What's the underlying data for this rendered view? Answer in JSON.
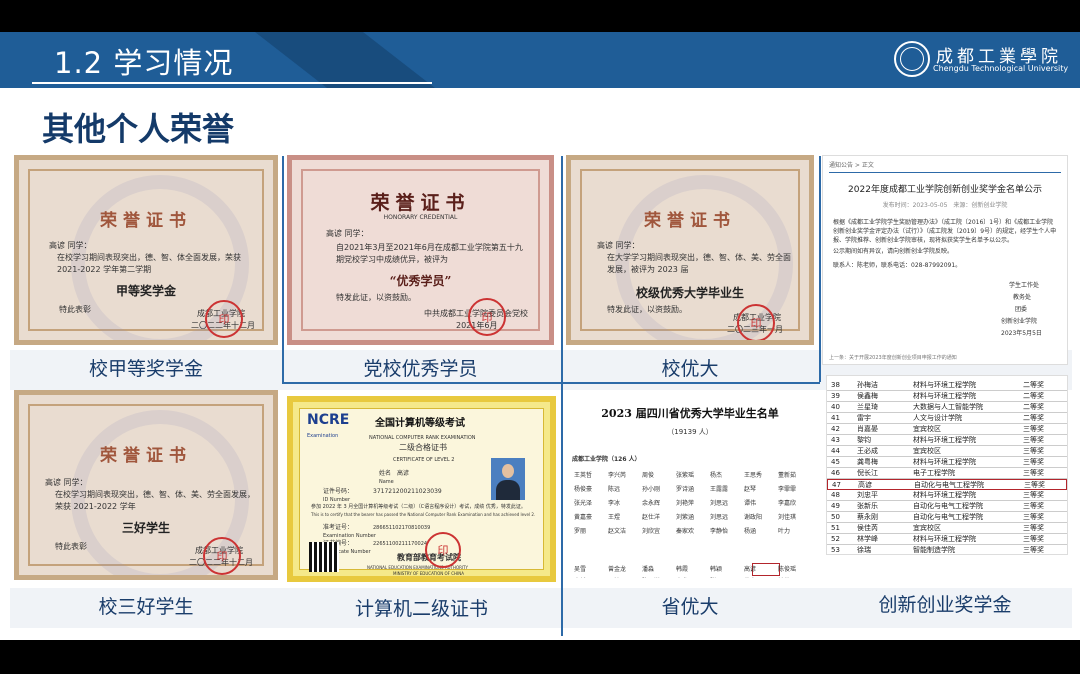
{
  "header": {
    "section_title": "1.2 学习情况",
    "logo_cn": "成都工業學院",
    "logo_en": "Chengdu Technological University"
  },
  "slide_title": "其他个人荣誉",
  "certificates": [
    {
      "title": "荣誉证书",
      "name": "高谚 同学：",
      "body": "在校学习期间表现突出，德、智、体全面发展，荣获 2021-2022 学年第二学期",
      "award": "甲等奖学金",
      "closing": "特此表彰",
      "issuer": "成都工业学院",
      "date": "二〇二二年十二月",
      "caption": "校甲等奖学金"
    },
    {
      "title": "荣誉证书",
      "subtitle": "HONORARY CREDENTIAL",
      "name": "高谚 同学：",
      "body": "自2021年3月至2021年6月在成都工业学院第五十九期党校学习中成绩优异，被评为",
      "award": "“优秀学员”",
      "closing": "特发此证，以资鼓励。",
      "issuer": "中共成都工业学院委员会党校",
      "date": "2021年6月",
      "caption": "党校优秀学员"
    },
    {
      "title": "荣誉证书",
      "name": "高谚 同学：",
      "body": "在大学学习期间表现突出，德、智、体、美、劳全面发展，被评为 2023 届",
      "award": "校级优秀大学毕业生",
      "closing": "特发此证，以资鼓励。",
      "issuer": "成都工业学院",
      "date": "二〇二三年一月",
      "caption": "校优大"
    },
    {
      "title": "荣誉证书",
      "name": "高谚 同学：",
      "body": "在校学习期间表现突出，德、智、体、美、劳全面发展，荣获 2021-2022 学年",
      "award": "三好学生",
      "closing": "特此表彰",
      "issuer": "成都工业学院",
      "date": "二〇二二年十二月",
      "caption": "校三好学生"
    },
    {
      "logo": "NCRE",
      "logo_sub": "Examination",
      "title": "全国计算机等级考试",
      "title_en": "NATIONAL COMPUTER RANK EXAMINATION",
      "level": "二级合格证书",
      "level_en": "CERTIFICATE OF LEVEL 2",
      "name_label": "姓名",
      "name_label_en": "Name",
      "name": "高谚",
      "id_label": "证件号码：",
      "id_label_en": "ID Number",
      "id": "371721200211023039",
      "body": "参加 2022 年 3 月全国计算机等级考试（二级）（C语言程序设计）考试，成绩 优秀，特发此证。",
      "body_en": "This is to certify that the bearer has passed the National Computer Rank Examination and has achieved level 2.",
      "exam_no_label": "准考证号：",
      "exam_no_label_en": "Examination Number",
      "exam_no": "286651102170810039",
      "cert_no_label": "证书编号：",
      "cert_no_label_en": "Certificate Number",
      "cert_no": "22651100211170024",
      "authority": "教育部教育考试院",
      "authority_en": "NATIONAL EDUCATION EXAMINATIONS AUTHORITY",
      "ministry_en": "MINISTRY OF EDUCATION OF CHINA",
      "caption": "计算机二级证书"
    }
  ],
  "provincial": {
    "title": "2023 届四川省优秀大学毕业生名单",
    "count": "（19139 人）",
    "school": "成都工业学院（126 人）",
    "names_row1": [
      "王英哲",
      "李兴芮",
      "周俊",
      "张紫瑶",
      "杨杰",
      "王思秀",
      "董新茹"
    ],
    "names_row2": [
      "杨俊豪",
      "陈远",
      "孙小刚",
      "罗诗涵",
      "王露露",
      "赵琴",
      "李霏霏"
    ],
    "names_row3": [
      "张光泽",
      "李冰",
      "余永辉",
      "刘艳萍",
      "刘思远",
      "谭伟",
      "李嘉欣"
    ],
    "names_row4": [
      "黄嘉豪",
      "王煜",
      "赵仕洋",
      "刘紫涵",
      "刘思远",
      "谢政阳",
      "刘佳琪"
    ],
    "names_row5": [
      "罗丽",
      "赵文洁",
      "刘欣宜",
      "秦家欢",
      "李静怡",
      "杨涵",
      "叶力"
    ],
    "names_row6": [
      "吴雪",
      "曾金龙",
      "潘淼",
      "韩霞",
      "韩颖",
      "高谚",
      "陈俊瑶"
    ],
    "names_row7": [
      "李然",
      "吴敏",
      "陈思洋",
      "卢龙",
      "张思",
      "蒋宇",
      "钟萍"
    ],
    "highlighted": "高谚",
    "caption": "省优大"
  },
  "innovation": {
    "breadcrumb": "通知公告 > 正文",
    "title": "2022年度成都工业学院创新创业奖学金名单公示",
    "meta": "发布时间：2023-05-05　来源：创新创业学院",
    "body1": "根据《成都工业学院学生奖励管理办法》（成工院〔2016〕1号）和《成都工业学院创新创业奖学金评定办法（试行）》（成工院发〔2019〕9号）的规定，经学生个人申报、学院推荐、创新创业学院审核，现将拟获奖学生名单予以公示。",
    "body2": "公示期间如有异议，请向创新创业学院反映。",
    "contact": "联系人：陈老师，联系电话：028-87992091。",
    "sign1": "学生工作处",
    "sign2": "教务处",
    "sign3": "团委",
    "sign4": "创新创业学院",
    "sign_date": "2023年5月5日",
    "footer": "上一条：关于开展2023年度创新创业项目申报工作的通知",
    "rows": [
      [
        "38",
        "孙梅洁",
        "材料与环境工程学院",
        "二等奖"
      ],
      [
        "39",
        "侯鑫梅",
        "材料与环境工程学院",
        "二等奖"
      ],
      [
        "40",
        "兰星琦",
        "大数据与人工智能学院",
        "二等奖"
      ],
      [
        "41",
        "雷宇",
        "人文与设计学院",
        "二等奖"
      ],
      [
        "42",
        "肖嘉晏",
        "宜宾校区",
        "三等奖"
      ],
      [
        "43",
        "黎钧",
        "材料与环境工程学院",
        "三等奖"
      ],
      [
        "44",
        "王必成",
        "宜宾校区",
        "三等奖"
      ],
      [
        "45",
        "龚粤梅",
        "材料与环境工程学院",
        "三等奖"
      ],
      [
        "46",
        "倪长江",
        "电子工程学院",
        "三等奖"
      ],
      [
        "47",
        "高谚",
        "自动化与电气工程学院",
        "三等奖"
      ],
      [
        "48",
        "刘忠平",
        "材料与环境工程学院",
        "三等奖"
      ],
      [
        "49",
        "张新乐",
        "自动化与电气工程学院",
        "三等奖"
      ],
      [
        "50",
        "蔡永刚",
        "自动化与电气工程学院",
        "三等奖"
      ],
      [
        "51",
        "侯佳芮",
        "宜宾校区",
        "三等奖"
      ],
      [
        "52",
        "林学峰",
        "材料与环境工程学院",
        "三等奖"
      ],
      [
        "53",
        "徐瑞",
        "智能制造学院",
        "三等奖"
      ]
    ],
    "highlight_index": 9,
    "caption": "创新创业奖学金"
  },
  "colors": {
    "header_bg": "#1f5d97",
    "title_text": "#143a69",
    "cert_border": "#c6a984",
    "highlight": "#b3252c"
  }
}
